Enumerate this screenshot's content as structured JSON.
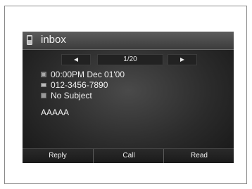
{
  "header": {
    "title": "inbox",
    "icon": "phone-icon"
  },
  "pager": {
    "counter": "1/20",
    "prev_icon": "left-arrow-icon",
    "next_icon": "right-arrow-icon"
  },
  "message": {
    "datetime": "00:00PM Dec 01'00",
    "sender": "012-3456-7890",
    "subject": "No Subject",
    "body": "AAAAA"
  },
  "actions": {
    "reply": "Reply",
    "call": "Call",
    "read": "Read"
  }
}
